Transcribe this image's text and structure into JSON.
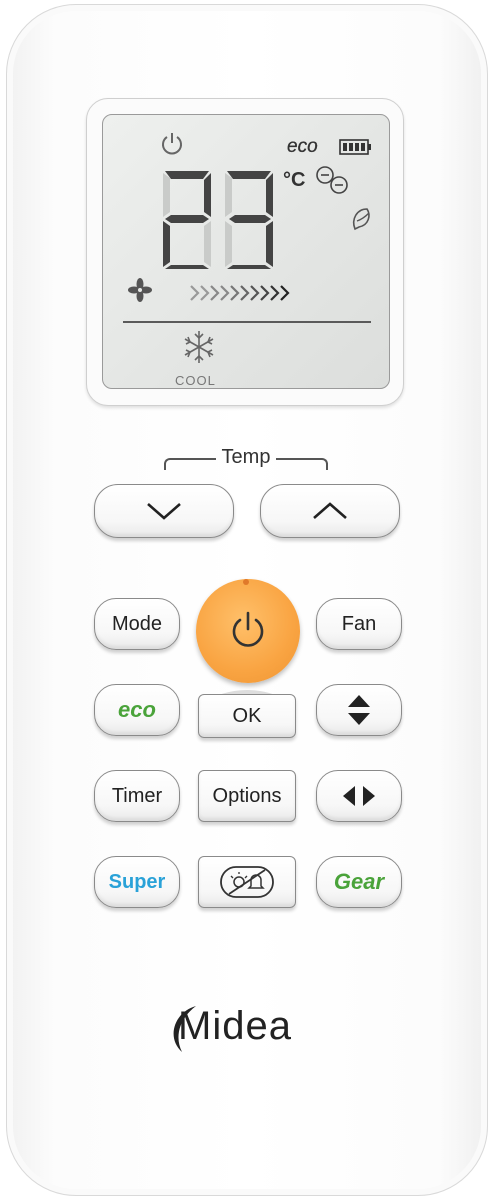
{
  "lcd": {
    "temperature": "23",
    "unit": "°C",
    "eco_label": "eco",
    "mode_label": "COOL"
  },
  "buttons": {
    "temp_label": "Temp",
    "mode": "Mode",
    "fan": "Fan",
    "eco": "eco",
    "ok": "OK",
    "timer": "Timer",
    "options": "Options",
    "super": "Super",
    "gear": "Gear"
  },
  "brand": {
    "logo": "Midea"
  },
  "colors": {
    "power": "#f9a442",
    "eco_green": "#4aa33a",
    "super_blue": "#2aa2d8",
    "lcd_bg": "#e6e8e6"
  },
  "icons": [
    "power-icon",
    "battery-icon",
    "fan-icon",
    "snowflake-icon",
    "wind-arrows-icon",
    "leaf-icon",
    "timer-icon",
    "chevron-down-icon",
    "chevron-up-icon",
    "vertical-swing-icon",
    "horizontal-swing-icon",
    "light-buzzer-icon"
  ]
}
